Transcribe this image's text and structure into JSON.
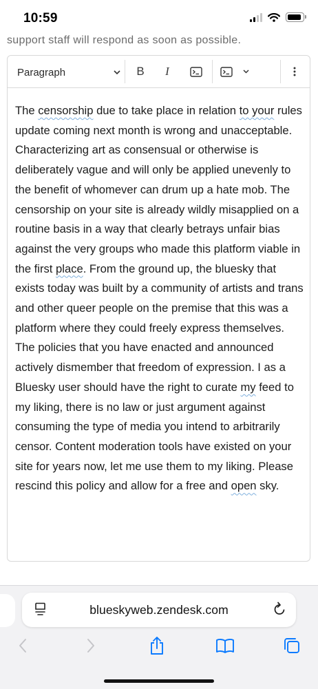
{
  "status_bar": {
    "time": "10:59",
    "icons": [
      "cellular-signal-icon",
      "wifi-icon",
      "battery-icon"
    ]
  },
  "page": {
    "helper_text": "support staff will respond as soon as possible."
  },
  "editor": {
    "toolbar": {
      "format_value": "Paragraph",
      "bold_label": "B",
      "italic_label": "I",
      "icons": [
        "chevron-down-icon",
        "code-icon",
        "code-block-icon",
        "more-vertical-icon"
      ]
    },
    "body_segments": [
      {
        "text": "The ",
        "flagged": false
      },
      {
        "text": "censorship",
        "flagged": true
      },
      {
        "text": " due to take place in relation ",
        "flagged": false
      },
      {
        "text": "to your",
        "flagged": true
      },
      {
        "text": " rules update coming next month is wrong and unacceptable. Characterizing art as consensual or otherwise is deliberately vague and will only be applied unevenly to the benefit of whomever can drum up a hate mob. The censorship on your site is already wildly misapplied on a routine basis in a way that clearly betrays unfair bias against the very groups who made this platform viable in the first ",
        "flagged": false
      },
      {
        "text": "place",
        "flagged": true
      },
      {
        "text": ". From the ground up, the bluesky that exists today was built by a community of artists and trans and other queer people on the premise that this was a platform where they could freely express themselves. The policies that you have enacted and announced actively dismember that freedom of expression. I as a Bluesky user should have the right to curate ",
        "flagged": false
      },
      {
        "text": "my",
        "flagged": true
      },
      {
        "text": " feed to my liking, there is no law or just argument against consuming the type of media you intend to arbitrarily censor. Content moderation tools have existed on your site for years now, let me use them to my liking. Please rescind this policy and allow for a free and ",
        "flagged": false
      },
      {
        "text": "open",
        "flagged": true
      },
      {
        "text": " sky.",
        "flagged": false
      }
    ]
  },
  "browser": {
    "url": "blueskyweb.zendesk.com",
    "icons": [
      "page-menu-icon",
      "reload-icon",
      "back-icon",
      "forward-icon",
      "share-icon",
      "bookmarks-icon",
      "tabs-icon"
    ]
  },
  "colors": {
    "spellcheck_underline": "#7fb0de",
    "safari_blue": "#0a7aff",
    "disabled_gray": "#c5c5c9"
  }
}
